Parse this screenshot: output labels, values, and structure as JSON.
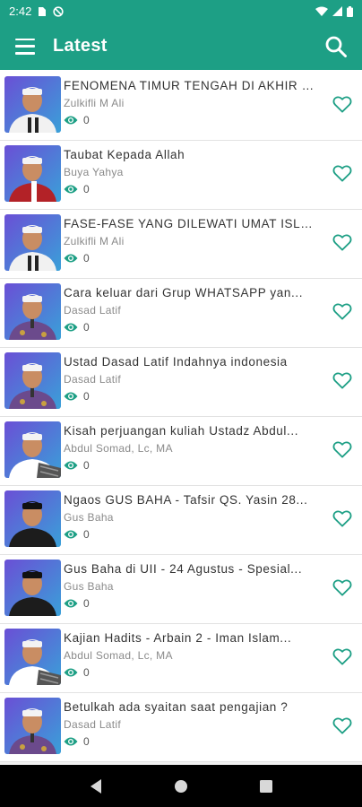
{
  "status_bar": {
    "time": "2:42"
  },
  "app_bar": {
    "title": "Latest"
  },
  "colors": {
    "primary": "#1d9f85",
    "accent": "#1d9f85"
  },
  "items": [
    {
      "title": "FENOMENA TIMUR TENGAH DI AKHIR ZA...",
      "author": "Zulkifli M Ali",
      "views": "0",
      "thumb": "purple-white"
    },
    {
      "title": "Taubat Kepada Allah",
      "author": "Buya Yahya",
      "views": "0",
      "thumb": "purple-red"
    },
    {
      "title": "FASE-FASE YANG DILEWATI UMAT ISLA...",
      "author": "Zulkifli M Ali",
      "views": "0",
      "thumb": "purple-white"
    },
    {
      "title": "Cara keluar dari Grup WHATSAPP yan...",
      "author": "Dasad Latif",
      "views": "0",
      "thumb": "purple-batik"
    },
    {
      "title": "Ustad Dasad Latif  Indahnya indonesia",
      "author": "Dasad Latif",
      "views": "0",
      "thumb": "purple-batik"
    },
    {
      "title": "Kisah perjuangan kuliah Ustadz Abdul...",
      "author": "Abdul Somad, Lc, MA",
      "views": "0",
      "thumb": "purple-plaid"
    },
    {
      "title": "Ngaos GUS BAHA - Tafsir QS. Yasin 28...",
      "author": "Gus Baha",
      "views": "0",
      "thumb": "purple-black"
    },
    {
      "title": "Gus Baha di UII - 24 Agustus - Spesial...",
      "author": "Gus Baha",
      "views": "0",
      "thumb": "purple-black"
    },
    {
      "title": "Kajian Hadits - Arbain 2 - Iman Islam...",
      "author": "Abdul Somad, Lc, MA",
      "views": "0",
      "thumb": "purple-plaid"
    },
    {
      "title": "Betulkah ada syaitan saat pengajian ?",
      "author": "Dasad Latif",
      "views": "0",
      "thumb": "purple-batik"
    }
  ]
}
